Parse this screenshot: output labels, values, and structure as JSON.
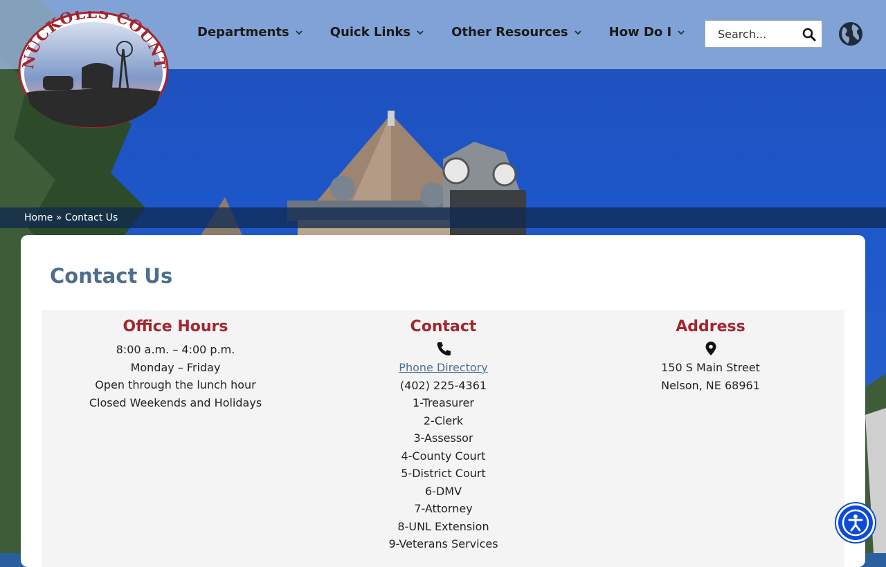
{
  "site": {
    "logo_text": "NUCKOLLS COUNTY"
  },
  "nav": {
    "items": [
      {
        "label": "Departments"
      },
      {
        "label": "Quick Links"
      },
      {
        "label": "Other Resources"
      },
      {
        "label": "How Do I"
      }
    ]
  },
  "search": {
    "placeholder": "Search..."
  },
  "breadcrumb": {
    "home": "Home",
    "separator": "»",
    "current": "Contact Us"
  },
  "page": {
    "title": "Contact Us"
  },
  "office_hours": {
    "heading": "Office Hours",
    "lines": [
      "8:00 a.m. – 4:00 p.m.",
      "Monday – Friday",
      "Open through the lunch hour",
      "Closed Weekends and Holidays"
    ]
  },
  "contact": {
    "heading": "Contact",
    "directory_link": "Phone Directory",
    "phone": "(402) 225-4361",
    "extensions": [
      "1-Treasurer",
      "2-Clerk",
      "3-Assessor",
      "4-County Court",
      "5-District Court",
      "6-DMV",
      "7-Attorney",
      "8-UNL Extension",
      "9-Veterans Services"
    ]
  },
  "address": {
    "heading": "Address",
    "lines": [
      "150 S Main Street",
      "Nelson, NE 68961"
    ]
  },
  "colors": {
    "accent_red": "#a3262e",
    "title_blue": "#4e6e90",
    "a11y_blue": "#0d4bd6"
  }
}
